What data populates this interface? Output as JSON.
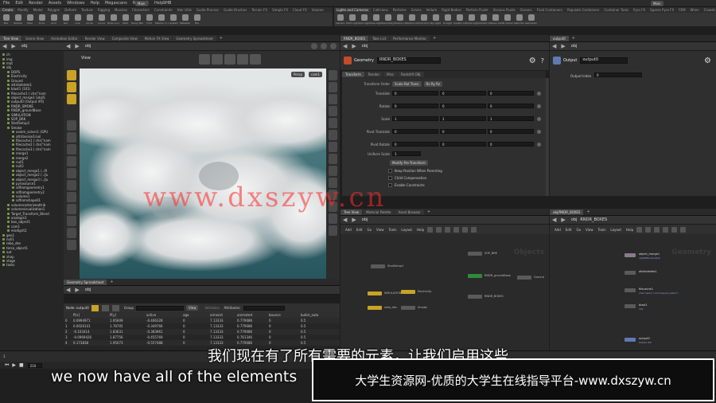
{
  "menu": [
    "File",
    "Edit",
    "Render",
    "Assets",
    "Windows",
    "Help",
    "Megascans",
    "Redshift",
    "Help"
  ],
  "desktop": {
    "label": "Main",
    "file": "SHB"
  },
  "desktop_right": "Main",
  "shelf_tabs_left": [
    "Create",
    "Modify",
    "Model",
    "Polygon",
    "Deform",
    "Texture",
    "Rigging",
    "Muscles",
    "Characters",
    "Constraints",
    "Hair Utils",
    "Guide Process",
    "Guide Brushes",
    "Terrain FX",
    "Simple FX",
    "Cloud FX",
    "Volume"
  ],
  "shelf_tabs_right": [
    "Lights and Cameras",
    "Collisions",
    "Particles",
    "Grains",
    "Vellum",
    "Rigid Bodies",
    "Particle Fluids",
    "Viscous Fluids",
    "Oceans",
    "Fluid Containers",
    "Populate Containers",
    "Container Tools",
    "Pyro FX",
    "Sparse Pyro FX",
    "FEM",
    "Wires",
    "Crowds",
    "Drive Simulation"
  ],
  "shelf_tools_left": [
    "Box",
    "Sphere",
    "Tube",
    "Torus",
    "Grid",
    "Null",
    "Line",
    "Circle",
    "Curve",
    "Draw Curve",
    "Path",
    "Spray Paint",
    "Font",
    "Platonic Solids",
    "L-System",
    "Metaball",
    "File"
  ],
  "shelf_tools_right": [
    "Camera",
    "Point Light",
    "Spot Light",
    "Area Light",
    "Geometry Light",
    "Volume Light",
    "Distant Light",
    "Environment Light",
    "Sky Light",
    "GI Light",
    "Caustic Light",
    "Portal Light",
    "Ambient Light",
    "Stereo Camera",
    "VR Camera",
    "Switcher",
    "Gamepad Camera"
  ],
  "left_tabs": [
    "Tree View",
    "Scene View",
    "Animation Editor",
    "Render View",
    "Composite View",
    "Motion FX View",
    "Geometry Spreadsheet"
  ],
  "mid_tabs": [
    "RNDR_BOXES",
    "Take List",
    "Performance Monitor"
  ],
  "right_tabs": [
    "output0"
  ],
  "tree_path": "obj",
  "viewport_path": "obj",
  "tree_items": [
    "ch",
    "img",
    "mat",
    "obj",
    "DOPS",
    "Electricity",
    "Ground",
    "attribdelete1",
    "blast1 (101)",
    "filecache1 ( chs(\"nam",
    "object_merge1 (obj/S",
    "output0 (Output #0)",
    "RNDR_SMOKE",
    "RNDR_groundBase",
    "SIMULATION",
    "SOP_BRK",
    "ShotSetup1",
    "Smoke",
    "axiom_solver1 (GPU",
    "attribnoise1/vol",
    "filecache1 ( chs(\"nam",
    "filecache2 ( chs(\"nam",
    "filecache3 ( chs(\"nam",
    "merge1",
    "merge2",
    "null1",
    "null2",
    "object_merge1 (../R",
    "object_merge2 (../Ju",
    "object_merge3 (../Ju",
    "pyrosource1",
    "sdfromgeometry1",
    "sdfromgeometry2",
    "volume1",
    "sdfromshape01",
    "volumerasterizeattrib",
    "volumevisualization1",
    "Target_Transform_Blend",
    "analogin1",
    "box_object1",
    "cam1",
    "erodigrit2",
    "geo1",
    "null1",
    "rebo_des",
    "terso_object1",
    "out",
    "shop",
    "stage",
    "tasks"
  ],
  "viewport": {
    "title": "View",
    "persp": "Persp",
    "cam": "cam1"
  },
  "param_header": {
    "type": "Geometry",
    "name": "RNDR_BOXES"
  },
  "param_tabs": [
    "Transform",
    "Render",
    "Misc",
    "Redshift OBJ"
  ],
  "transform_order": {
    "label": "Transform Order",
    "value": "Scale Rot Trans",
    "rot": "Rx Ry Rz"
  },
  "params": [
    {
      "label": "Translate",
      "v": [
        "0",
        "0",
        "0"
      ]
    },
    {
      "label": "Rotate",
      "v": [
        "0",
        "0",
        "0"
      ]
    },
    {
      "label": "Scale",
      "v": [
        "1",
        "1",
        "1"
      ]
    },
    {
      "label": "Pivot Translate",
      "v": [
        "0",
        "0",
        "0"
      ]
    },
    {
      "label": "Pivot Rotate",
      "v": [
        "0",
        "0",
        "0"
      ]
    }
  ],
  "uniform_scale": {
    "label": "Uniform Scale",
    "value": "1"
  },
  "modify_pre": "Modify Pre-Transform",
  "checks": [
    "Keep Position When Parenting",
    "Child Compensation",
    "Enable Constraints"
  ],
  "output_panel": {
    "title": "Output",
    "name": "output0",
    "index_label": "Output Index",
    "index_value": "0"
  },
  "network_tabs": [
    "Tree View",
    "Material Palette",
    "Asset Browser"
  ],
  "network_path": "obj",
  "network_menu": [
    "Add",
    "Edit",
    "Go",
    "View",
    "Tools",
    "Layout",
    "Help"
  ],
  "network_watermark": "Objects",
  "objects_nodes": [
    "ShotSetup1",
    "SOP_BRK",
    "RNDR_SMOKE",
    "RNDR_groundBase",
    "SIMULATION",
    "Electricity",
    "rebo_des",
    "Smoke",
    "RNDR_BOXES",
    "Ground"
  ],
  "geo_tabs": [
    "obj/RNDR_BOXES"
  ],
  "geo_path": "RNDR_BOXES",
  "geo_watermark": "Geometry",
  "geo_nodes": [
    {
      "name": "object_merge1",
      "sub": "obj/SIM/LA/output"
    },
    {
      "name": "attribdelete1",
      "sub": ""
    },
    {
      "name": "filecache1",
      "sub": "chs(\"name\") chs(\"export_exten\")"
    },
    {
      "name": "blast1",
      "sub": "101"
    },
    {
      "name": "output0",
      "sub": "Output #0"
    }
  ],
  "spreadsheet": {
    "tab": "Geometry Spreadsheet",
    "node": "Node: output0",
    "group_label": "Group",
    "view": "View",
    "intrinsics": "Intrinsics",
    "attributes": "Attributes:",
    "columns": [
      "",
      "P[x]",
      "P[y]",
      "active",
      "age",
      "airresist",
      "animated",
      "bounce",
      "bullet_auto"
    ],
    "rows": [
      [
        "0",
        "0.0994971",
        "1.95609",
        "-0.406328",
        "0",
        "7.13333",
        "0.779086",
        "0",
        "0.5"
      ],
      [
        "1",
        "0.0026141",
        "1.78705",
        "-0.349766",
        "0",
        "7.13333",
        "0.779086",
        "0",
        "0.5"
      ],
      [
        "2",
        "-0.103414",
        "1.83631",
        "-0.383961",
        "0",
        "7.13333",
        "0.779086",
        "0",
        "0.5"
      ],
      [
        "3",
        "-0.0969426",
        "1.87756",
        "-0.455769",
        "0",
        "7.13333",
        "0.761346",
        "0",
        "0.5"
      ],
      [
        "4",
        "0.173838",
        "1.95073",
        "-0.557488",
        "0",
        "7.13333",
        "0.779086",
        "0",
        "0.5"
      ]
    ]
  },
  "timeline": {
    "frame": "210",
    "start": "1"
  },
  "subtitle_cn": "我们现在有了所有需要的元素，让我们启用这些",
  "subtitle_en": "we now have all of the elements",
  "watermark": "www.dxszyw.cn",
  "banner": "大学生资源网-优质的大学生在线指导平台-www.dxszyw.cn",
  "colors": {
    "bg": "#1e1e1e",
    "panel": "#2b2b2b",
    "accent": "#e07b00",
    "watermark": "#ff2a2a",
    "banner_border": "#ffffff"
  }
}
